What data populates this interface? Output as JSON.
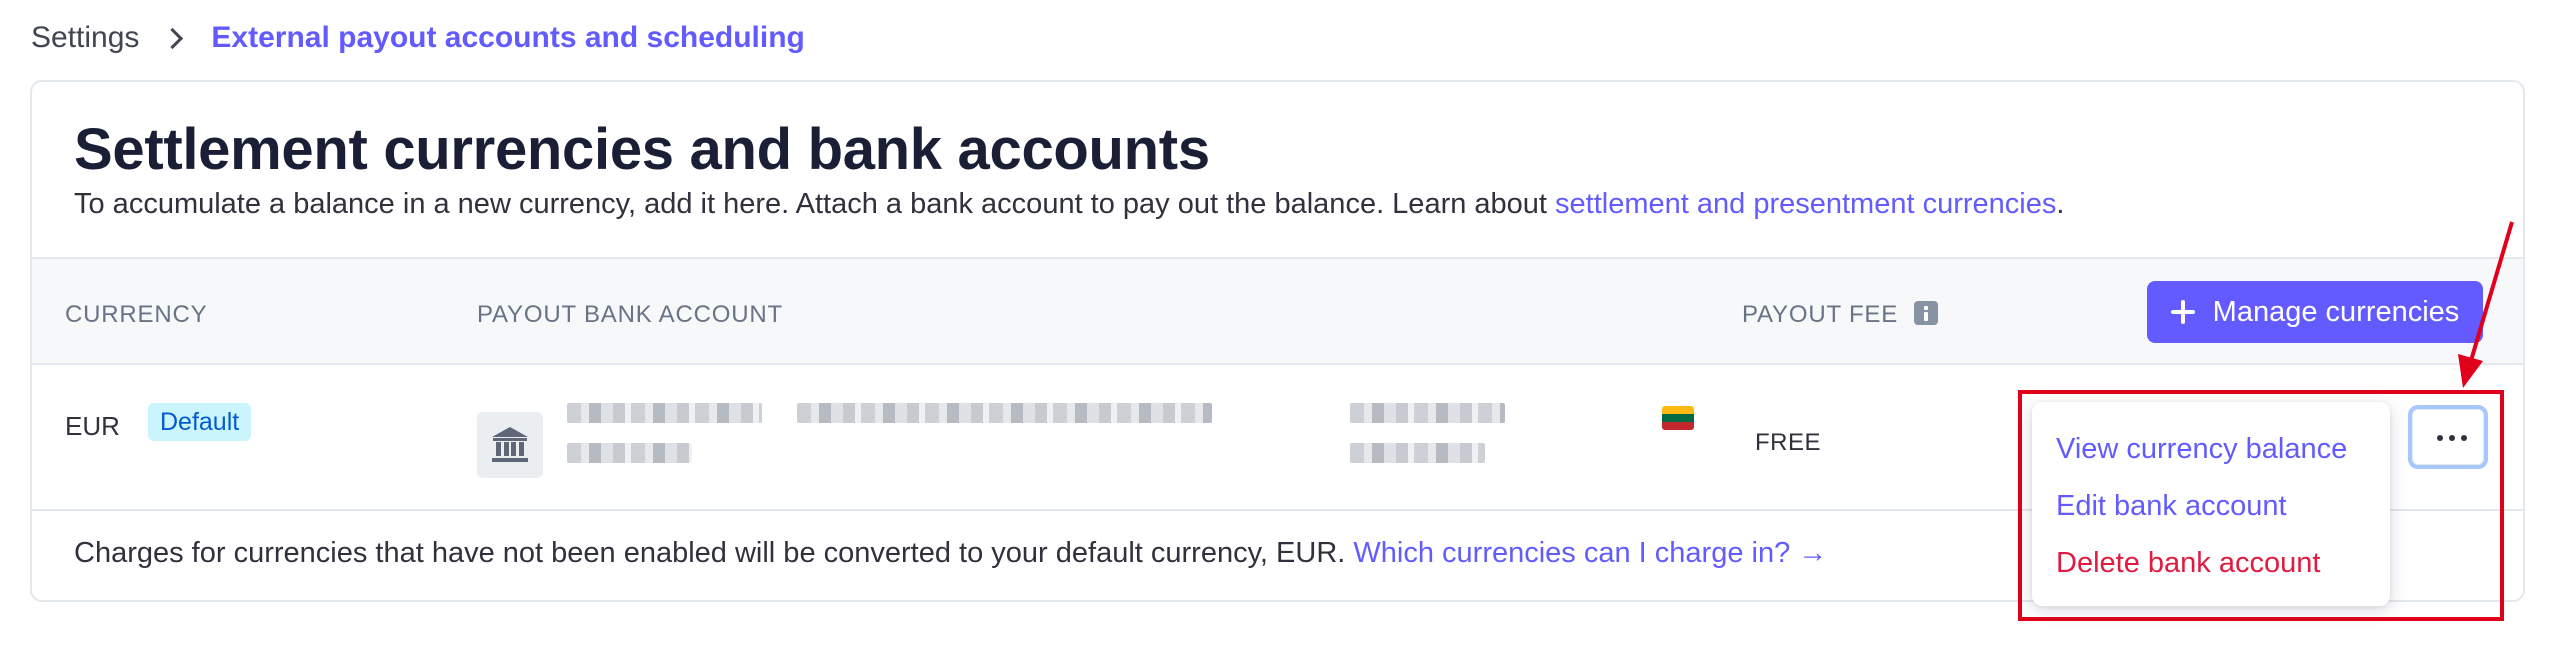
{
  "breadcrumb": {
    "root": "Settings",
    "current": "External payout accounts and scheduling"
  },
  "card": {
    "title": "Settlement currencies and bank accounts",
    "description_prefix": "To accumulate a balance in a new currency, add it here. Attach a bank account to pay out the balance. Learn about ",
    "description_link": "settlement and presentment currencies",
    "description_suffix": "."
  },
  "table": {
    "headers": {
      "currency": "CURRENCY",
      "payout_bank_account": "PAYOUT BANK ACCOUNT",
      "payout_fee": "PAYOUT FEE"
    },
    "manage_button": "Manage currencies",
    "rows": [
      {
        "currency": "EUR",
        "badge": "Default",
        "fee": "FREE",
        "flag_colors": [
          "#fdb913",
          "#006a44",
          "#c1272d"
        ]
      }
    ]
  },
  "footer": {
    "text_prefix": "Charges for currencies that have not been enabled will be converted to your default currency, ",
    "currency": "EUR",
    "text_mid": ". ",
    "link": "Which currencies can I charge in? →"
  },
  "menu": {
    "items": [
      {
        "label": "View currency balance"
      },
      {
        "label": "Edit bank account"
      },
      {
        "label": "Delete bank account"
      }
    ]
  },
  "icons": {
    "bank": "bank-icon",
    "info": "info-icon",
    "plus": "plus-icon",
    "more": "more-horizontal-icon",
    "chevron": "chevron-right-icon"
  },
  "colors": {
    "accent": "#635bff",
    "danger": "#df1b41",
    "annotation": "#e0001b",
    "badge_bg": "#cbf5fd",
    "badge_text": "#045ad0"
  }
}
